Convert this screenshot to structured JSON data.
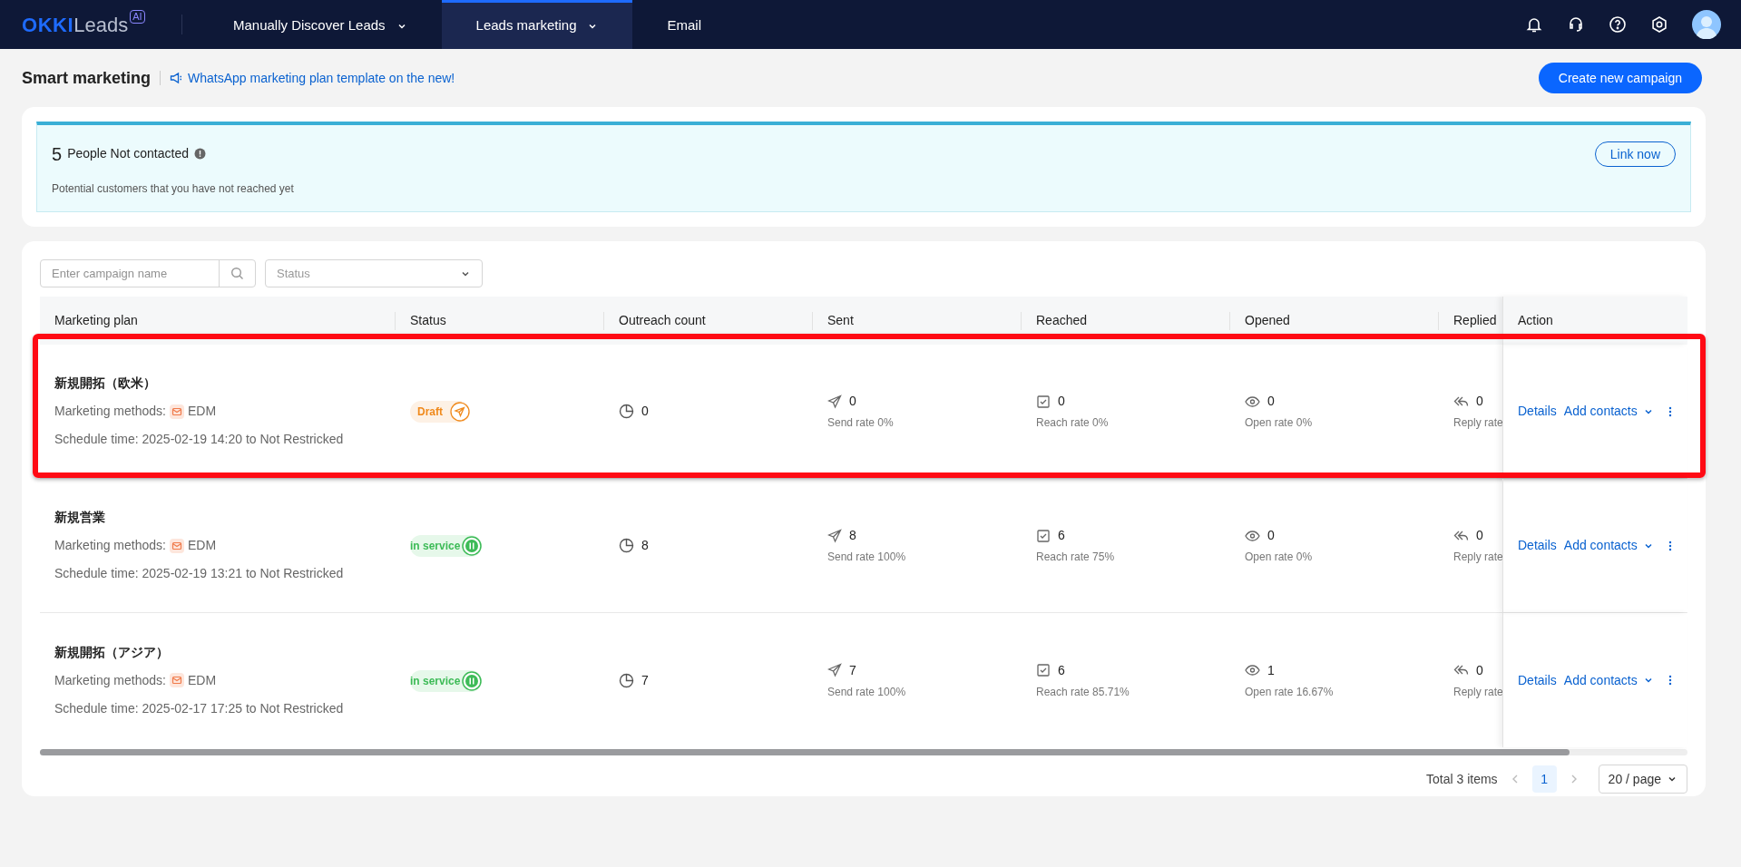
{
  "nav": {
    "logo_brand": "OKKI",
    "logo_product": "Leads",
    "logo_badge": "AI",
    "tabs": [
      {
        "label": "Manually Discover Leads",
        "dropdown": true,
        "selected": false
      },
      {
        "label": "Leads marketing",
        "dropdown": true,
        "selected": true
      },
      {
        "label": "Email",
        "dropdown": false,
        "selected": false
      }
    ]
  },
  "page": {
    "title": "Smart marketing",
    "announcement": "WhatsApp marketing plan template on the new!",
    "create_button": "Create new campaign"
  },
  "banner": {
    "count": "5",
    "label": "People Not contacted",
    "description": "Potential customers that you have not reached yet",
    "button": "Link now"
  },
  "filters": {
    "search_placeholder": "Enter campaign name",
    "status_placeholder": "Status"
  },
  "table": {
    "columns": [
      "Marketing plan",
      "Status",
      "Outreach count",
      "Sent",
      "Reached",
      "Opened",
      "Replied",
      "Action"
    ],
    "rows": [
      {
        "highlighted": true,
        "name": "新規開拓（欧米）",
        "method_label": "Marketing methods:",
        "method": "EDM",
        "schedule": "Schedule time: 2025-02-19 14:20 to Not Restricked",
        "status": {
          "label": "Draft",
          "kind": "draft"
        },
        "outreach": "0",
        "sent": "0",
        "sent_rate": "Send rate 0%",
        "reached": "0",
        "reach_rate": "Reach rate 0%",
        "opened": "0",
        "open_rate": "Open rate 0%",
        "replied": "0",
        "reply_rate": "Reply rate",
        "actions": {
          "details": "Details",
          "add_contacts": "Add contacts"
        }
      },
      {
        "highlighted": false,
        "name": "新規営業",
        "method_label": "Marketing methods:",
        "method": "EDM",
        "schedule": "Schedule time: 2025-02-19 13:21 to Not Restricked",
        "status": {
          "label": "in service",
          "kind": "running"
        },
        "outreach": "8",
        "sent": "8",
        "sent_rate": "Send rate 100%",
        "reached": "6",
        "reach_rate": "Reach rate 75%",
        "opened": "0",
        "open_rate": "Open rate 0%",
        "replied": "0",
        "reply_rate": "Reply rate",
        "actions": {
          "details": "Details",
          "add_contacts": "Add contacts"
        }
      },
      {
        "highlighted": false,
        "name": "新規開拓（アジア）",
        "method_label": "Marketing methods:",
        "method": "EDM",
        "schedule": "Schedule time: 2025-02-17 17:25 to Not Restricked",
        "status": {
          "label": "in service",
          "kind": "running"
        },
        "outreach": "7",
        "sent": "7",
        "sent_rate": "Send rate 100%",
        "reached": "6",
        "reach_rate": "Reach rate 85.71%",
        "opened": "1",
        "open_rate": "Open rate 16.67%",
        "replied": "0",
        "reply_rate": "Reply rate",
        "actions": {
          "details": "Details",
          "add_contacts": "Add contacts"
        }
      }
    ]
  },
  "pagination": {
    "total": "Total 3 items",
    "pages": [
      {
        "label": "1",
        "selected": true
      }
    ],
    "page_size": "20 / page"
  }
}
